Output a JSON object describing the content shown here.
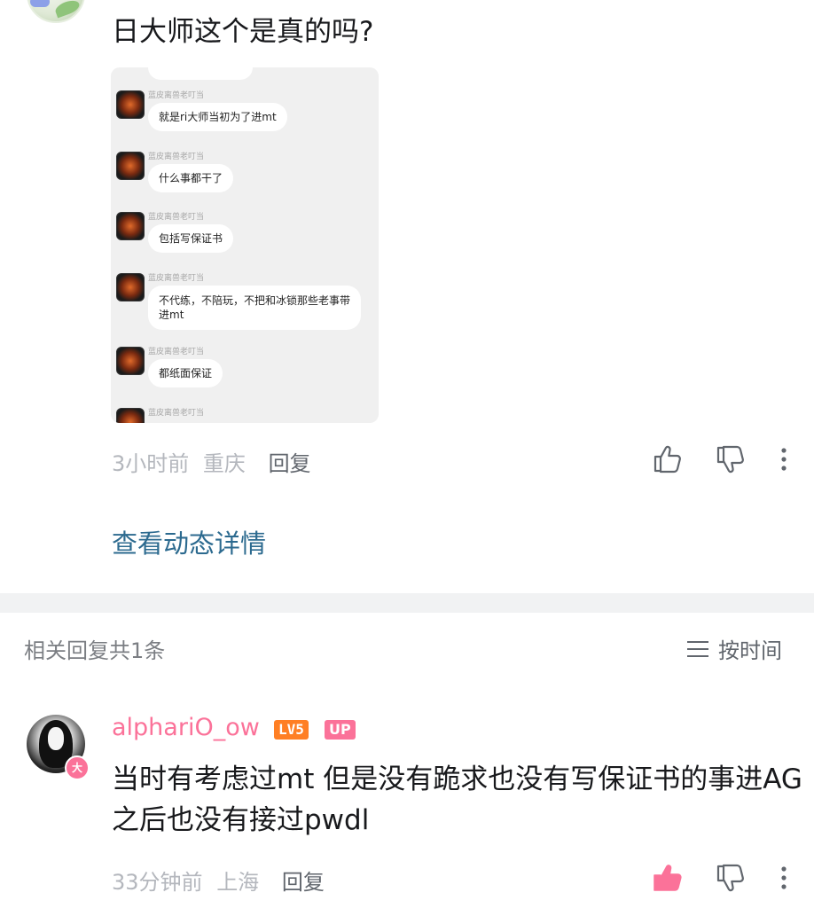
{
  "comment": {
    "text": "日大师这个是真的吗?",
    "time": "3小时前",
    "location": "重庆",
    "reply_label": "回复",
    "image": {
      "messages": [
        {
          "name": "蓝皮离兽老叮当",
          "text": "就是ri大师当初为了进mt"
        },
        {
          "name": "蓝皮离兽老叮当",
          "text": "什么事都干了"
        },
        {
          "name": "蓝皮离兽老叮当",
          "text": "包括写保证书"
        },
        {
          "name": "蓝皮离兽老叮当",
          "text_line1": "不代练，不陪玩，不把和冰锁那些老事带",
          "text_line2": "进mt"
        },
        {
          "name": "蓝皮离兽老叮当",
          "text": "都纸面保证"
        },
        {
          "name": "蓝皮离兽老叮当"
        }
      ]
    }
  },
  "view_detail": "查看动态详情",
  "related": {
    "count_label": "相关回复共1条",
    "sort_label": "按时间"
  },
  "reply": {
    "username": "alphariO_ow",
    "level_badge": "LV5",
    "up_badge": "UP",
    "avatar_badge": "大",
    "text": "当时有考虑过mt 但是没有跪求也没有写保证书的事进AG之后也没有接过pwdl",
    "time": "33分钟前",
    "location": "上海",
    "reply_label": "回复",
    "liked": true
  },
  "colors": {
    "accent_pink": "#fb7299",
    "link_blue": "#2c6a8f",
    "level_orange": "#ff7f24",
    "meta_gray": "#b4b7bd"
  },
  "icons": [
    "thumbs-up-icon",
    "thumbs-down-icon",
    "more-vertical-icon",
    "sort-lines-icon"
  ]
}
